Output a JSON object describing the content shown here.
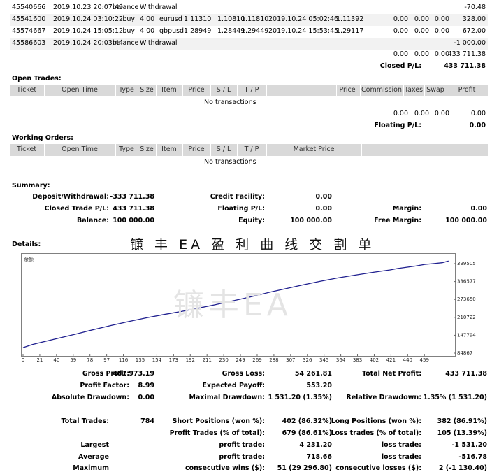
{
  "trades": [
    {
      "ticket": "45540666",
      "time": "2019.10.23 20:07:49",
      "type": "balance",
      "size": "",
      "item": "Withdrawal",
      "price": "",
      "sl": "",
      "tp": "",
      "close_time": "",
      "close_price": "",
      "commission": "",
      "taxes": "",
      "swap": "",
      "profit": "-70.48"
    },
    {
      "ticket": "45541600",
      "time": "2019.10.24 03:10:22",
      "type": "buy",
      "size": "4.00",
      "item": "eurusd",
      "price": "1.11310",
      "sl": "1.10810",
      "tp": "1.11810",
      "close_time": "2019.10.24 05:02:46",
      "close_price": "1.11392",
      "commission": "0.00",
      "taxes": "0.00",
      "swap": "0.00",
      "profit": "328.00"
    },
    {
      "ticket": "45574667",
      "time": "2019.10.24 15:05:12",
      "type": "buy",
      "size": "4.00",
      "item": "gbpusd",
      "price": "1.28949",
      "sl": "1.28449",
      "tp": "1.29449",
      "close_time": "2019.10.24 15:53:45",
      "close_price": "1.29117",
      "commission": "0.00",
      "taxes": "0.00",
      "swap": "0.00",
      "profit": "672.00"
    },
    {
      "ticket": "45586603",
      "time": "2019.10.24 20:03:44",
      "type": "balance",
      "size": "",
      "item": "Withdrawal",
      "price": "",
      "sl": "",
      "tp": "",
      "close_time": "",
      "close_price": "",
      "commission": "",
      "taxes": "",
      "swap": "",
      "profit": "-1 000.00"
    }
  ],
  "closed_totals": {
    "commission": "0.00",
    "taxes": "0.00",
    "swap": "0.00",
    "profit": "433 711.38"
  },
  "closed_pl": {
    "label": "Closed P/L:",
    "value": "433 711.38"
  },
  "open_trades": {
    "title": "Open Trades:",
    "headers": [
      "Ticket",
      "Open Time",
      "Type",
      "Size",
      "Item",
      "Price",
      "S / L",
      "T / P",
      "",
      "Price",
      "Commission",
      "Taxes",
      "Swap",
      "Profit"
    ],
    "empty": "No transactions",
    "totals": {
      "commission": "0.00",
      "taxes": "0.00",
      "swap": "0.00",
      "profit": "0.00"
    },
    "floating_label": "Floating P/L:",
    "floating_value": "0.00"
  },
  "working_orders": {
    "title": "Working Orders:",
    "headers": [
      "Ticket",
      "Open Time",
      "Type",
      "Size",
      "Item",
      "Price",
      "S / L",
      "T / P",
      "Market Price"
    ],
    "empty": "No transactions"
  },
  "summary": {
    "title": "Summary:",
    "deposit_label": "Deposit/Withdrawal:",
    "deposit_value": "-333 711.38",
    "credit_label": "Credit Facility:",
    "credit_value": "0.00",
    "closed_label": "Closed Trade P/L:",
    "closed_value": "433 711.38",
    "floating_label": "Floating P/L:",
    "floating_value": "0.00",
    "margin_label": "Margin:",
    "margin_value": "0.00",
    "balance_label": "Balance:",
    "balance_value": "100 000.00",
    "equity_label": "Equity:",
    "equity_value": "100 000.00",
    "free_margin_label": "Free Margin:",
    "free_margin_value": "100 000.00"
  },
  "details": {
    "title": "Details:",
    "chart_title_cn": "镰 丰 EA 盈 利 曲 线 交 割 单",
    "watermark": "镰丰EA",
    "chart_corner_label": "余额"
  },
  "chart_data": {
    "type": "line",
    "title": "镰 丰 EA 盈 利 曲 线 交 割 单",
    "xlabel": "",
    "ylabel": "",
    "x_ticks": [
      "0",
      "21",
      "40",
      "59",
      "78",
      "97",
      "116",
      "135",
      "154",
      "173",
      "192",
      "211",
      "230",
      "249",
      "269",
      "288",
      "307",
      "326",
      "345",
      "364",
      "383",
      "402",
      "421",
      "440",
      "459"
    ],
    "y_ticks": [
      "399505",
      "336577",
      "273650",
      "210722",
      "147794",
      "84867"
    ],
    "ylim": [
      70000,
      415000
    ],
    "xlim": [
      0,
      470
    ],
    "series": [
      {
        "name": "余额",
        "color": "#1f1f8f",
        "x": [
          0,
          10,
          21,
          40,
          59,
          78,
          97,
          116,
          135,
          154,
          173,
          192,
          211,
          230,
          249,
          269,
          288,
          307,
          326,
          345,
          364,
          383,
          402,
          410,
          421,
          430,
          440,
          450,
          459,
          466
        ],
        "y": [
          90000,
          101000,
          110000,
          125000,
          140000,
          156000,
          171000,
          185000,
          198000,
          210000,
          221000,
          233000,
          246000,
          260000,
          274000,
          290000,
          304000,
          318000,
          331000,
          343000,
          353000,
          363000,
          372000,
          377000,
          382000,
          386000,
          392000,
          395000,
          398000,
          404000
        ]
      }
    ],
    "grid": false,
    "legend": "top-left"
  },
  "stats": {
    "gross_profit_label": "Gross Profit:",
    "gross_profit": "487 973.19",
    "gross_loss_label": "Gross Loss:",
    "gross_loss": "54 261.81",
    "net_profit_label": "Total Net Profit:",
    "net_profit": "433 711.38",
    "profit_factor_label": "Profit Factor:",
    "profit_factor": "8.99",
    "expected_payoff_label": "Expected Payoff:",
    "expected_payoff": "553.20",
    "abs_dd_label": "Absolute Drawdown:",
    "abs_dd": "0.00",
    "max_dd_label": "Maximal Drawdown:",
    "max_dd": "1 531.20 (1.35%)",
    "rel_dd_label": "Relative Drawdown:",
    "rel_dd": "1.35% (1 531.20)",
    "total_trades_label": "Total Trades:",
    "total_trades": "784",
    "short_label": "Short Positions (won %):",
    "short": "402 (86.32%)",
    "long_label": "Long Positions (won %):",
    "long": "382 (86.91%)",
    "profit_trades_label": "Profit Trades (% of total):",
    "profit_trades": "679 (86.61%)",
    "loss_trades_label": "Loss trades (% of total):",
    "loss_trades": "105 (13.39%)",
    "largest_label": "Largest",
    "largest_profit_label": "profit trade:",
    "largest_profit": "4 231.20",
    "largest_loss_label": "loss trade:",
    "largest_loss": "-1 531.20",
    "average_label": "Average",
    "average_profit_label": "profit trade:",
    "average_profit": "718.66",
    "average_loss_label": "loss trade:",
    "average_loss": "-516.78",
    "maximum_label": "Maximum",
    "max_wins_label": "consecutive wins ($):",
    "max_wins": "51 (29 296.80)",
    "max_losses_label": "consecutive losses ($):",
    "max_losses": "2 (-1 130.40)"
  }
}
